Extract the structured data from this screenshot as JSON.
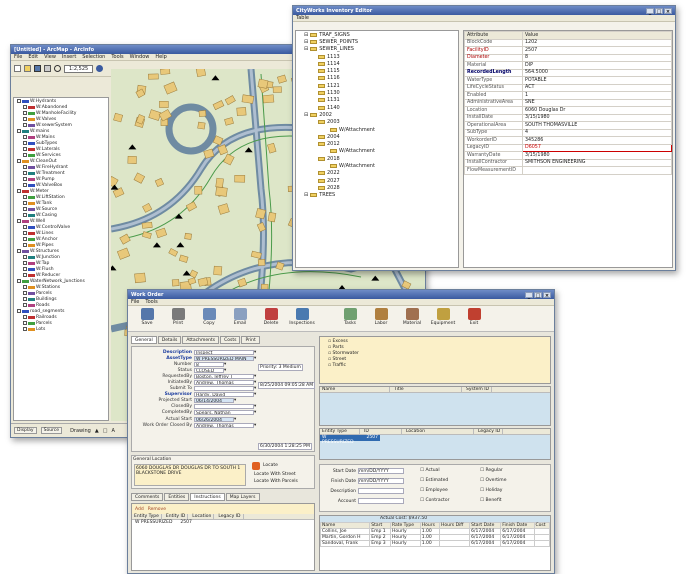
{
  "arcmap": {
    "title": "[Untitled] - ArcMap - ArcInfo",
    "menus": [
      "File",
      "Edit",
      "View",
      "Insert",
      "Selection",
      "Tools",
      "Window",
      "Help"
    ],
    "scale": "1:2,525",
    "toc_items": [
      "W:Hydrants",
      "W:Abandoned",
      "W:ManholeFacility",
      "W:Valves",
      "W:sewerSystem",
      "W:mains",
      "W:Mains",
      "SubTypes",
      "W:Laterals",
      "W:Services",
      "W:CleanOut",
      "W:FireHydrant",
      "W:Treatment",
      "W:Pump",
      "W:ValveBox",
      "W:Meter",
      "W:LiftStation",
      "W:Tank",
      "W:Source",
      "W:Casing",
      "W:Well",
      "W:ControlValve",
      "W:Lines",
      "W:Anchor",
      "W:Pipes",
      "W:Structures",
      "W:Junction",
      "W:Tap",
      "W:Flush",
      "W:Reducer",
      "WaterNetwork_Junctions",
      "W:Stations",
      "Parcels",
      "Buildings",
      "Roads",
      "road_segments",
      "Railroads",
      "Parcels",
      "Lots"
    ],
    "tabs": [
      "Display",
      "Source"
    ],
    "drawing": "Drawing"
  },
  "inventory": {
    "title": "CityWorks Inventory Editor",
    "menu": "Table",
    "tree": [
      "TRAF_SIGNS",
      "SEWER_POINTS",
      "SEWER_LINES",
      "1113",
      "1114",
      "1115",
      "1116",
      "1121",
      "1130",
      "1131",
      "1140",
      "2002",
      "2003",
      "W/Attachment",
      "2004",
      "2012",
      "W/Attachment",
      "2018",
      "W/Attachment",
      "2022",
      "2027",
      "2028",
      "TREES"
    ],
    "headers": [
      "Attribute",
      "Value"
    ],
    "rows": [
      {
        "k": "BlockCode",
        "v": "1202",
        "s": "k"
      },
      {
        "k": "FacilityID",
        "v": "2507",
        "s": "kr"
      },
      {
        "k": "Diameter",
        "v": "8",
        "s": "kr"
      },
      {
        "k": "Material",
        "v": "DIP",
        "s": "k"
      },
      {
        "k": "RecordedLength",
        "v": "564.5000",
        "s": "kb"
      },
      {
        "k": "WaterType",
        "v": "POTABLE",
        "s": "k"
      },
      {
        "k": "LifeCycleStatus",
        "v": "ACT",
        "s": "k"
      },
      {
        "k": "Enabled",
        "v": "1",
        "s": "k"
      },
      {
        "k": "AdministrativeArea",
        "v": "SNE",
        "s": "k"
      },
      {
        "k": "Location",
        "v": "6060 Douglas Dr",
        "s": "k"
      },
      {
        "k": "InstallDate",
        "v": "3/15/1980",
        "s": "k"
      },
      {
        "k": "OperationalArea",
        "v": "SOUTH THOMASVILLE",
        "s": "k"
      },
      {
        "k": "SubType",
        "v": "4",
        "s": "k"
      },
      {
        "k": "WorkorderID",
        "v": "345286",
        "s": "k"
      },
      {
        "k": "LegacyID",
        "v": "D6057",
        "s": "k"
      },
      {
        "k": "WarrantyDate",
        "v": "3/15/1980",
        "s": "k"
      },
      {
        "k": "InstallContractor",
        "v": "SMITHSON ENGINEERING",
        "s": "k"
      },
      {
        "k": "FlowMeasurementID",
        "v": "",
        "s": "k"
      }
    ]
  },
  "workorder": {
    "title": "Work Order",
    "menus": [
      "File",
      "Tools"
    ],
    "tools": [
      "Save",
      "Print",
      "Copy",
      "Email",
      "Delete",
      "Inspections",
      "Tasks",
      "Labor",
      "Material",
      "Equipment",
      "Exit"
    ],
    "tabs": [
      "General",
      "Details",
      "Attachments",
      "Costs",
      "Print"
    ],
    "fields": [
      {
        "l": "Description",
        "v": "Inspect",
        "b": true
      },
      {
        "l": "AssetType",
        "v": "W PRESSURIZED MAIN",
        "b": true
      },
      {
        "l": "Number",
        "v": "8",
        "b": false
      },
      {
        "l": "Status",
        "v": "CLOSED",
        "b": false
      },
      {
        "l": "RequestedBy",
        "v": "Boston, Jeffrey T",
        "b": false
      },
      {
        "l": "InitiatedBy",
        "v": "Andrew, Thomas",
        "b": false
      },
      {
        "l": "Submit To",
        "v": "",
        "b": false
      },
      {
        "l": "Supervisor",
        "v": "Hardy, David",
        "b": true
      },
      {
        "l": "Projected Start",
        "v": "06/14/2004",
        "b": false
      },
      {
        "l": "ClosedBy",
        "v": "",
        "b": false
      },
      {
        "l": "CompletedBy",
        "v": "Spears, Nathan",
        "b": false
      },
      {
        "l": "Actual Start",
        "v": "06/26/2004",
        "b": false
      },
      {
        "l": "Work Order Closed By",
        "v": "Andrew, Thomas",
        "b": false
      }
    ],
    "priority": "Priority: 3 Medium",
    "init_date": "8/25/2004 09:05:28 AM",
    "close_date": "6/30/2004 1:28:25 PM",
    "general_location": "General Location",
    "location_text": "6060 DOUGLAS DR DOUGLAS DR TO SOUTH 1 BLACKSTONE DRIVE",
    "locate": "Locate",
    "locate_opts": [
      "Locate With Street",
      "Locate With Parcels"
    ],
    "bottom_tabs": [
      "Comments",
      "Entities",
      "Instructions",
      "Map Layers"
    ],
    "entity_hdr": [
      "Entity Type",
      "Entity ID",
      "Location",
      "Legacy ID"
    ],
    "entity_row": [
      "W PRESSURIZED",
      "2507"
    ],
    "task_tree": [
      "Excess",
      "Parts",
      "Stormwater",
      "Street",
      "Traffic"
    ],
    "mid_hdr": [
      "Name",
      "Title",
      "System ID"
    ],
    "ent_hdr": [
      "Entity Type",
      "ID",
      "Location",
      "Legacy ID"
    ],
    "ent_row": [
      "W PRESSURIZED",
      "2507"
    ],
    "sched": [
      {
        "l": "Start Date",
        "v": "mm/DD/YYYY"
      },
      {
        "l": "Finish Date",
        "v": "mm/DD/YYYY"
      },
      {
        "l": "Description",
        "v": ""
      },
      {
        "l": "Account",
        "v": ""
      }
    ],
    "checks": [
      "Actual",
      "Estimated",
      "Employee",
      "Contractor"
    ],
    "checks2": [
      "Regular",
      "Overtime",
      "Holiday",
      "Benefit"
    ],
    "links": [
      "Add",
      "Remove",
      "Switch Actual Cost"
    ],
    "cost_hdr": [
      "Name",
      "Start",
      "Rate Type",
      "Hours",
      "Hours Diff",
      "Start Date",
      "Finish Date",
      "Cost"
    ],
    "cost_rows": [
      [
        "Collins, Joe",
        "Emp 1",
        "Hourly",
        "1.00",
        "",
        "6/17/2004",
        "6/17/2004",
        ""
      ],
      [
        "Martin, Gordon H",
        "Emp 2",
        "Hourly",
        "1.00",
        "",
        "6/17/2004",
        "6/17/2004",
        ""
      ],
      [
        "Sandoval, Frank",
        "Emp 3",
        "Hourly",
        "1.00",
        "",
        "6/17/2004",
        "6/17/2004",
        ""
      ]
    ],
    "actual_total": "Actual Cost: $937.50"
  }
}
